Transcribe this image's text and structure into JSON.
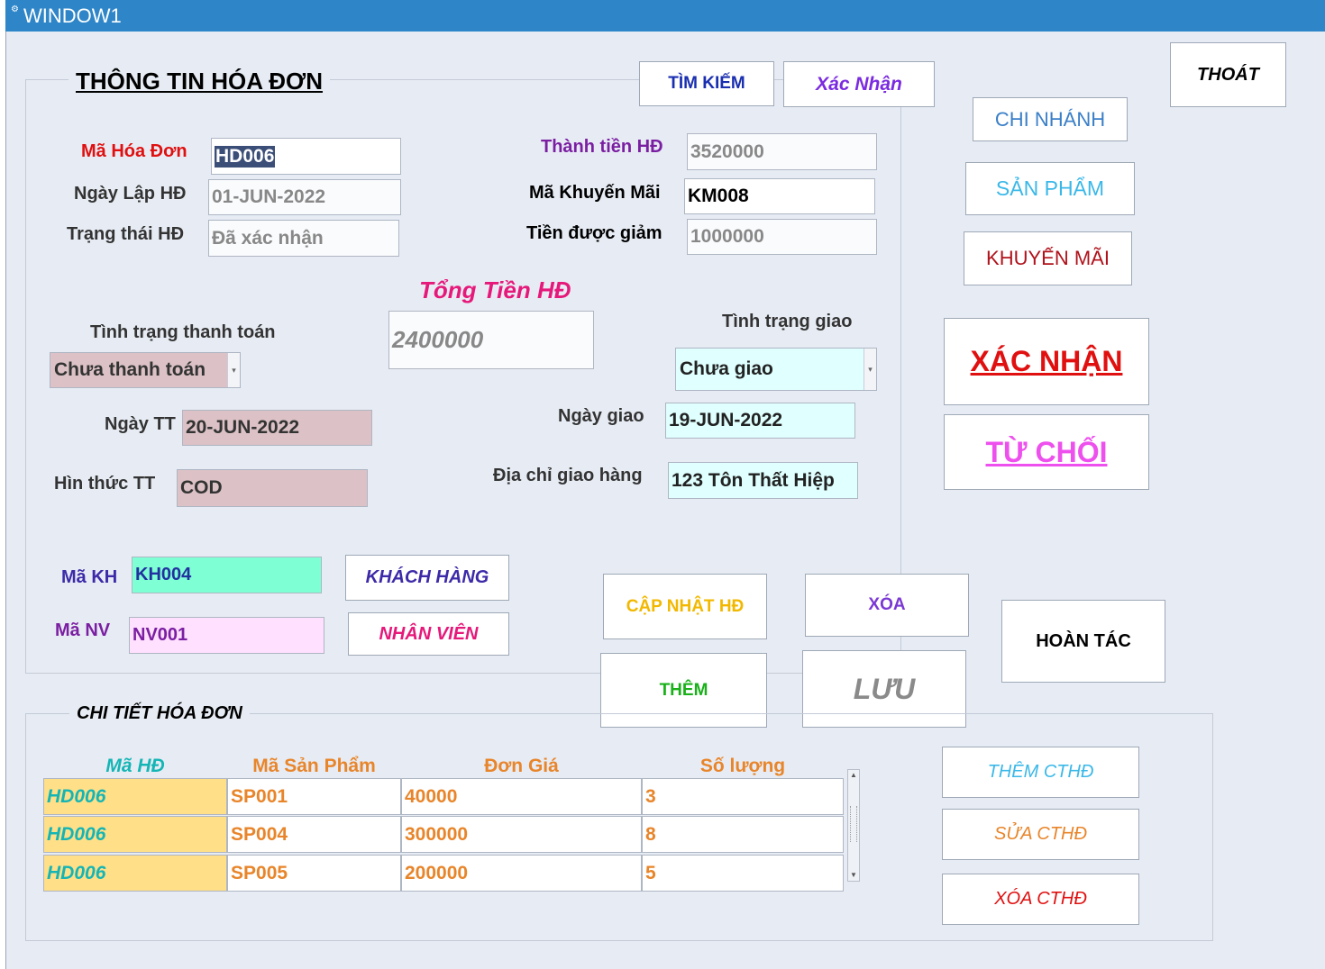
{
  "window": {
    "title": "WINDOW1",
    "icon": "app-icon"
  },
  "colors": {
    "titlebar": "#2e86c8",
    "background": "#e7ecf4",
    "red": "#e01010",
    "purple": "#7b1fa2",
    "customer_field": "#7fffd4",
    "employee_field": "#ffe0ff",
    "payment_field": "#dcc2c6",
    "delivery_field": "#e0ffff",
    "detail_col1": "#ffdf88"
  },
  "invoice": {
    "section_title": "THÔNG TIN HÓA ĐƠN",
    "ma_hoa_don": {
      "label": "Mã Hóa Đơn",
      "value": "HD006"
    },
    "ngay_lap": {
      "label": "Ngày Lập HĐ",
      "value": "01-JUN-2022"
    },
    "trang_thai": {
      "label": "Trạng thái HĐ",
      "value": "Đã xác nhận"
    },
    "thanh_tien": {
      "label": "Thành tiền HĐ",
      "value": "3520000"
    },
    "ma_khuyen_mai": {
      "label": "Mã Khuyến Mãi",
      "value": "KM008"
    },
    "tien_giam": {
      "label": "Tiền được giảm",
      "value": "1000000"
    },
    "tong_tien": {
      "label": "Tổng Tiền HĐ",
      "value": "2400000"
    },
    "tinh_trang_tt": {
      "label": "Tình trạng thanh toán",
      "value": "Chưa thanh toán"
    },
    "ngay_tt": {
      "label": "Ngày TT",
      "value": "20-JUN-2022"
    },
    "hinh_thuc_tt": {
      "label": "Hìn thức TT",
      "value": "COD"
    },
    "tinh_trang_giao": {
      "label": "Tình trạng giao",
      "value": "Chưa giao"
    },
    "ngay_giao": {
      "label": "Ngày giao",
      "value": "19-JUN-2022"
    },
    "dia_chi": {
      "label": "Địa chỉ giao hàng",
      "value": "123 Tôn Thất Hiệp"
    },
    "ma_kh": {
      "label": "Mã KH",
      "value": "KH004"
    },
    "ma_nv": {
      "label": "Mã NV",
      "value": "NV001"
    }
  },
  "buttons": {
    "tim_kiem": "TÌM KIẾM",
    "xac_nhan_small": "Xác Nhận",
    "thoat": "THOÁT",
    "chi_nhanh": "CHI NHÁNH",
    "san_pham": "SẢN PHẨM",
    "khuyen_mai": "KHUYẾN MÃI",
    "xac_nhan": "XÁC NHẬN",
    "tu_choi": "TỪ CHỐI",
    "khach_hang": "KHÁCH HÀNG",
    "nhan_vien": "NHÂN VIÊN",
    "cap_nhat": "CẬP NHẬT HĐ",
    "xoa": "XÓA",
    "hoan_tac": "HOÀN TÁC",
    "them": "THÊM",
    "luu": "LƯU",
    "them_cthd": "THÊM CTHĐ",
    "sua_cthd": "SỬA CTHĐ",
    "xoa_cthd": "XÓA CTHĐ"
  },
  "details": {
    "section_title": "CHI TIẾT HÓA ĐƠN",
    "columns": [
      "Mã HĐ",
      "Mã Sản Phẩm",
      "Đơn Giá",
      "Số lượng"
    ],
    "rows": [
      [
        "HD006",
        "SP001",
        "40000",
        "3"
      ],
      [
        "HD006",
        "SP004",
        "300000",
        "8"
      ],
      [
        "HD006",
        "SP005",
        "200000",
        "5"
      ]
    ]
  }
}
